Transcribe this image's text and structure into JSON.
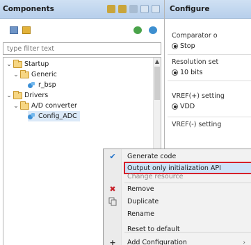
{
  "components_panel": {
    "title": "Components",
    "filter_placeholder": "type filter text",
    "tree": [
      {
        "label": "Startup",
        "level": 0,
        "kind": "folder",
        "expanded": true
      },
      {
        "label": "Generic",
        "level": 1,
        "kind": "folder",
        "expanded": true
      },
      {
        "label": "r_bsp",
        "level": 2,
        "kind": "component"
      },
      {
        "label": "Drivers",
        "level": 0,
        "kind": "folder",
        "expanded": true
      },
      {
        "label": "A/D converter",
        "level": 1,
        "kind": "folder",
        "expanded": true
      },
      {
        "label": "Config_ADC",
        "level": 2,
        "kind": "component",
        "selected": true
      }
    ]
  },
  "configure_panel": {
    "title": "Configure",
    "groups": [
      {
        "label": "Comparator o",
        "value": "Stop"
      },
      {
        "label": "Resolution set",
        "value": "10 bits"
      },
      {
        "label": "VREF(+) setting",
        "value": "VDD"
      },
      {
        "label": "VREF(-) setting",
        "value": ""
      }
    ]
  },
  "context_menu": {
    "items": [
      {
        "label": "Generate code",
        "icon": "checkmark-icon",
        "disabled": false
      },
      {
        "label": "Output only initialization API",
        "icon": "",
        "disabled": false,
        "highlighted": true
      },
      {
        "label": "Change resource",
        "icon": "",
        "disabled": true
      },
      {
        "label": "Remove",
        "icon": "remove-x-icon",
        "disabled": false
      },
      {
        "label": "Duplicate",
        "icon": "duplicate-icon",
        "disabled": false
      },
      {
        "label": "Rename",
        "icon": "",
        "disabled": false
      },
      {
        "label": "Reset to default",
        "icon": "",
        "disabled": false
      },
      {
        "label": "Add Configuration",
        "icon": "plus-icon",
        "disabled": false,
        "has_submenu": true
      }
    ],
    "highlight_color": "#d6202a"
  }
}
